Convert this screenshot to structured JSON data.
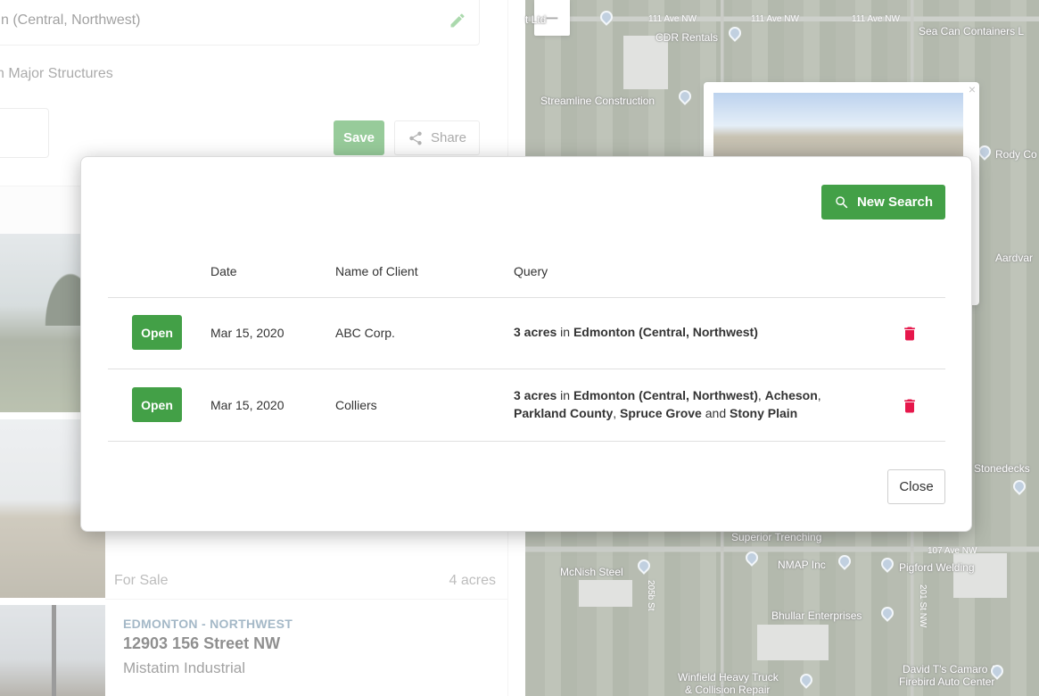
{
  "background": {
    "search_value": "n (Central, Northwest)",
    "structures_text": "n Major Structures",
    "save_label": "Save",
    "share_label": "Share",
    "card1": {
      "status": "For Sale",
      "size": "4 acres"
    },
    "card2": {
      "region": "EDMONTON - NORTHWEST",
      "address": "12903 156 Street NW",
      "name": "Mistatim Industrial"
    },
    "map": {
      "zoom_out": "−",
      "streets": [
        "111 Ave NW",
        "111 Ave NW",
        "111 Ave NW",
        "107 Ave NW",
        "205b St",
        "201 St NW"
      ],
      "places": [
        "CDR Rentals",
        "Sea Can Containers L",
        "Streamline Construction",
        "Rody Co",
        "Aardvar",
        "Stonedecks",
        "Superior Trenching",
        "McNish Steel",
        "NMAP Inc",
        "Pigford Welding",
        "Bhullar Enterprises",
        "Winfield Heavy Truck",
        "& Collision Repair",
        "David T's Camaro &",
        "Firebird Auto Center",
        "t Ltd"
      ]
    }
  },
  "modal": {
    "new_search_label": "New Search",
    "columns": {
      "date": "Date",
      "client": "Name of Client",
      "query": "Query"
    },
    "rows": [
      {
        "open_label": "Open",
        "date": "Mar 15, 2020",
        "client": "ABC Corp.",
        "query": {
          "size": "3 acres",
          "in": " in ",
          "location": "Edmonton (Central, Northwest)"
        }
      },
      {
        "open_label": "Open",
        "date": "Mar 15, 2020",
        "client": "Colliers",
        "query": {
          "size": "3 acres",
          "in": " in ",
          "loc1": "Edmonton (Central, Northwest)",
          "sep1": ", ",
          "loc2": "Acheson",
          "sep2": ",",
          "loc3": "Parkland County",
          "sep3": ", ",
          "loc4": "Spruce Grove",
          "and": " and ",
          "loc5": "Stony Plain"
        }
      }
    ],
    "close_label": "Close"
  },
  "colors": {
    "primary": "#43a047",
    "danger": "#e6174b"
  }
}
